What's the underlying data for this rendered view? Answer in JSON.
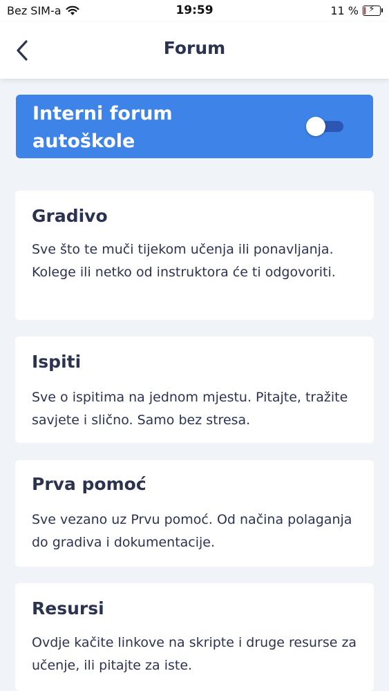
{
  "status_bar": {
    "carrier": "Bez SIM-a",
    "time": "19:59",
    "battery_percent": "11 %",
    "battery_level": 0.11
  },
  "nav": {
    "title": "Forum",
    "back_icon": "chevron-left-icon"
  },
  "banner": {
    "title": "Interni forum autoškole",
    "toggle_on": false
  },
  "forums": [
    {
      "title": "Gradivo",
      "description": "Sve što te muči tijekom učenja ili ponavljanja. Kolege ili netko od instruktora će ti odgovoriti."
    },
    {
      "title": "Ispiti",
      "description": "Sve o ispitima na jednom mjestu. Pitajte, tražite savjete i slično. Samo bez stresa."
    },
    {
      "title": "Prva pomoć",
      "description": "Sve vezano uz Prvu pomoć. Od načina polaganja do gradiva i dokumentacije."
    },
    {
      "title": "Resursi",
      "description": "Ovdje kačite linkove na skripte i druge resurse za učenje, ili pitajte za iste."
    }
  ],
  "colors": {
    "accent": "#3d83e8",
    "text": "#2b3350",
    "background": "#f0f3f7"
  }
}
